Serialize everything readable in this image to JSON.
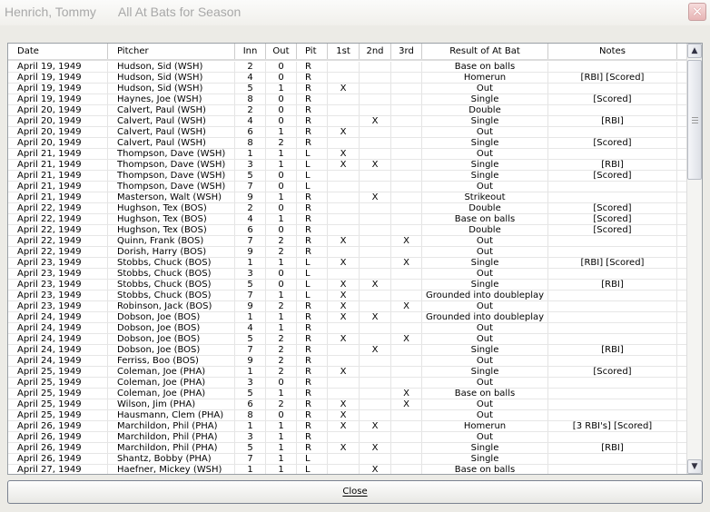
{
  "window": {
    "player": "Henrich, Tommy",
    "title": "All At Bats for Season",
    "close_icon": "close-x-icon"
  },
  "columns": [
    "Date",
    "Pitcher",
    "Inn",
    "Out",
    "Pit",
    "1st",
    "2nd",
    "3rd",
    "Result of At Bat",
    "Notes"
  ],
  "rows": [
    [
      "April 19, 1949",
      "Hudson, Sid (WSH)",
      "2",
      "0",
      "R",
      "",
      "",
      "",
      "Base on balls",
      ""
    ],
    [
      "April 19, 1949",
      "Hudson, Sid (WSH)",
      "4",
      "0",
      "R",
      "",
      "",
      "",
      "Homerun",
      "[RBI] [Scored]"
    ],
    [
      "April 19, 1949",
      "Hudson, Sid (WSH)",
      "5",
      "1",
      "R",
      "X",
      "",
      "",
      "Out",
      ""
    ],
    [
      "April 19, 1949",
      "Haynes, Joe (WSH)",
      "8",
      "0",
      "R",
      "",
      "",
      "",
      "Single",
      "[Scored]"
    ],
    [
      "April 20, 1949",
      "Calvert, Paul (WSH)",
      "2",
      "0",
      "R",
      "",
      "",
      "",
      "Double",
      ""
    ],
    [
      "April 20, 1949",
      "Calvert, Paul (WSH)",
      "4",
      "0",
      "R",
      "",
      "X",
      "",
      "Single",
      "[RBI]"
    ],
    [
      "April 20, 1949",
      "Calvert, Paul (WSH)",
      "6",
      "1",
      "R",
      "X",
      "",
      "",
      "Out",
      ""
    ],
    [
      "April 20, 1949",
      "Calvert, Paul (WSH)",
      "8",
      "2",
      "R",
      "",
      "",
      "",
      "Single",
      "[Scored]"
    ],
    [
      "April 21, 1949",
      "Thompson, Dave (WSH)",
      "1",
      "1",
      "L",
      "X",
      "",
      "",
      "Out",
      ""
    ],
    [
      "April 21, 1949",
      "Thompson, Dave (WSH)",
      "3",
      "1",
      "L",
      "X",
      "X",
      "",
      "Single",
      "[RBI]"
    ],
    [
      "April 21, 1949",
      "Thompson, Dave (WSH)",
      "5",
      "0",
      "L",
      "",
      "",
      "",
      "Single",
      "[Scored]"
    ],
    [
      "April 21, 1949",
      "Thompson, Dave (WSH)",
      "7",
      "0",
      "L",
      "",
      "",
      "",
      "Out",
      ""
    ],
    [
      "April 21, 1949",
      "Masterson, Walt (WSH)",
      "9",
      "1",
      "R",
      "",
      "X",
      "",
      "Strikeout",
      ""
    ],
    [
      "April 22, 1949",
      "Hughson, Tex (BOS)",
      "2",
      "0",
      "R",
      "",
      "",
      "",
      "Double",
      "[Scored]"
    ],
    [
      "April 22, 1949",
      "Hughson, Tex (BOS)",
      "4",
      "1",
      "R",
      "",
      "",
      "",
      "Base on balls",
      "[Scored]"
    ],
    [
      "April 22, 1949",
      "Hughson, Tex (BOS)",
      "6",
      "0",
      "R",
      "",
      "",
      "",
      "Double",
      "[Scored]"
    ],
    [
      "April 22, 1949",
      "Quinn, Frank (BOS)",
      "7",
      "2",
      "R",
      "X",
      "",
      "X",
      "Out",
      ""
    ],
    [
      "April 22, 1949",
      "Dorish, Harry (BOS)",
      "9",
      "2",
      "R",
      "",
      "",
      "",
      "Out",
      ""
    ],
    [
      "April 23, 1949",
      "Stobbs, Chuck (BOS)",
      "1",
      "1",
      "L",
      "X",
      "",
      "X",
      "Single",
      "[RBI] [Scored]"
    ],
    [
      "April 23, 1949",
      "Stobbs, Chuck (BOS)",
      "3",
      "0",
      "L",
      "",
      "",
      "",
      "Out",
      ""
    ],
    [
      "April 23, 1949",
      "Stobbs, Chuck (BOS)",
      "5",
      "0",
      "L",
      "X",
      "X",
      "",
      "Single",
      "[RBI]"
    ],
    [
      "April 23, 1949",
      "Stobbs, Chuck (BOS)",
      "7",
      "1",
      "L",
      "X",
      "",
      "",
      "Grounded into doubleplay",
      ""
    ],
    [
      "April 23, 1949",
      "Robinson, Jack (BOS)",
      "9",
      "2",
      "R",
      "X",
      "",
      "X",
      "Out",
      ""
    ],
    [
      "April 24, 1949",
      "Dobson, Joe (BOS)",
      "1",
      "1",
      "R",
      "X",
      "X",
      "",
      "Grounded into doubleplay",
      ""
    ],
    [
      "April 24, 1949",
      "Dobson, Joe (BOS)",
      "4",
      "1",
      "R",
      "",
      "",
      "",
      "Out",
      ""
    ],
    [
      "April 24, 1949",
      "Dobson, Joe (BOS)",
      "5",
      "2",
      "R",
      "X",
      "",
      "X",
      "Out",
      ""
    ],
    [
      "April 24, 1949",
      "Dobson, Joe (BOS)",
      "7",
      "2",
      "R",
      "",
      "X",
      "",
      "Single",
      "[RBI]"
    ],
    [
      "April 24, 1949",
      "Ferriss, Boo (BOS)",
      "9",
      "2",
      "R",
      "",
      "",
      "",
      "Out",
      ""
    ],
    [
      "April 25, 1949",
      "Coleman, Joe (PHA)",
      "1",
      "2",
      "R",
      "X",
      "",
      "",
      "Single",
      "[Scored]"
    ],
    [
      "April 25, 1949",
      "Coleman, Joe (PHA)",
      "3",
      "0",
      "R",
      "",
      "",
      "",
      "Out",
      ""
    ],
    [
      "April 25, 1949",
      "Coleman, Joe (PHA)",
      "5",
      "1",
      "R",
      "",
      "",
      "X",
      "Base on balls",
      ""
    ],
    [
      "April 25, 1949",
      "Wilson, Jim (PHA)",
      "6",
      "2",
      "R",
      "X",
      "",
      "X",
      "Out",
      ""
    ],
    [
      "April 25, 1949",
      "Hausmann, Clem (PHA)",
      "8",
      "0",
      "R",
      "X",
      "",
      "",
      "Out",
      ""
    ],
    [
      "April 26, 1949",
      "Marchildon, Phil (PHA)",
      "1",
      "1",
      "R",
      "X",
      "X",
      "",
      "Homerun",
      "[3 RBI's] [Scored]"
    ],
    [
      "April 26, 1949",
      "Marchildon, Phil (PHA)",
      "3",
      "1",
      "R",
      "",
      "",
      "",
      "Out",
      ""
    ],
    [
      "April 26, 1949",
      "Marchildon, Phil (PHA)",
      "5",
      "1",
      "R",
      "X",
      "X",
      "",
      "Single",
      "[RBI]"
    ],
    [
      "April 26, 1949",
      "Shantz, Bobby (PHA)",
      "7",
      "1",
      "L",
      "",
      "",
      "",
      "Single",
      ""
    ],
    [
      "April 27, 1949",
      "Haefner, Mickey (WSH)",
      "1",
      "1",
      "L",
      "",
      "X",
      "",
      "Base on balls",
      ""
    ]
  ],
  "scrollbar": {
    "up_icon": "chevron-up-icon",
    "down_icon": "chevron-down-icon",
    "position_fraction": 0.0
  },
  "footer": {
    "close_label": "Close"
  }
}
